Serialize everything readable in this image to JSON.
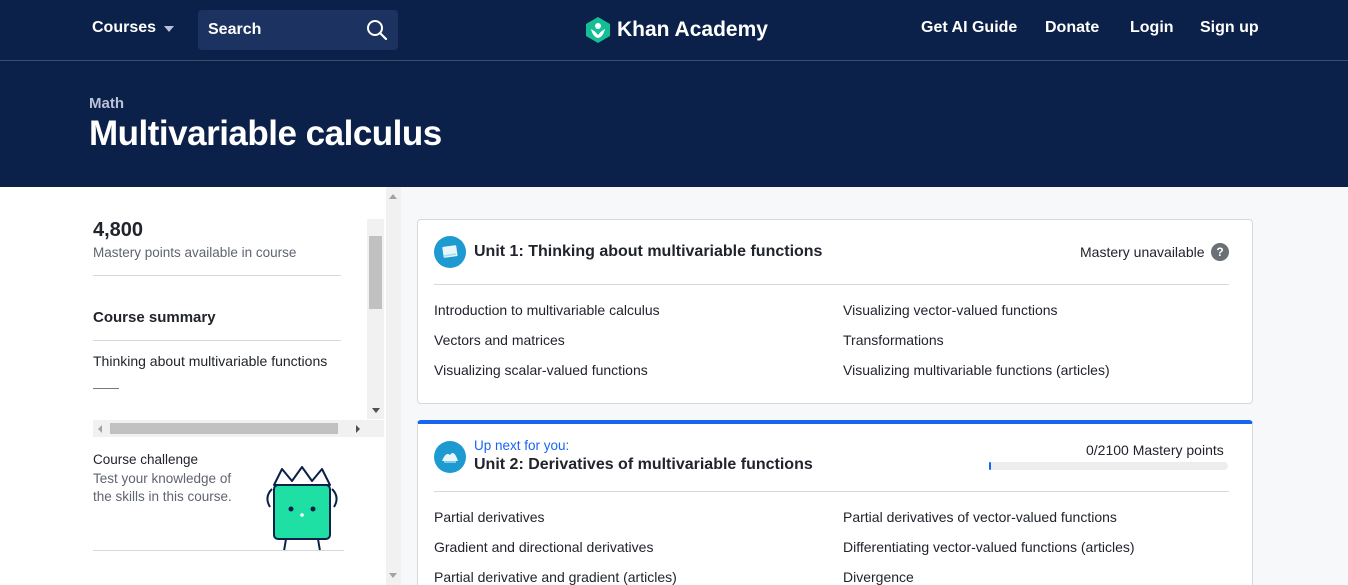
{
  "nav": {
    "courses_label": "Courses",
    "search_label": "Search",
    "logo_text": "Khan Academy",
    "links": [
      "Get AI Guide",
      "Donate",
      "Login",
      "Sign up"
    ]
  },
  "header": {
    "breadcrumb": "Math",
    "title": "Multivariable calculus"
  },
  "sidebar": {
    "mastery_points": "4,800",
    "mastery_label": "Mastery points available in course",
    "summary_title": "Course summary",
    "summary_item": "Thinking about multivariable functions",
    "summary_dash": "——",
    "challenge_title": "Course challenge",
    "challenge_desc": "Test your knowledge of the skills in this course."
  },
  "units": [
    {
      "title": "Unit 1: Thinking about multivariable functions",
      "status": "Mastery unavailable",
      "help": "?",
      "lessons_left": [
        "Introduction to multivariable calculus",
        "Vectors and matrices",
        "Visualizing scalar-valued functions"
      ],
      "lessons_right": [
        "Visualizing vector-valued functions",
        "Transformations",
        "Visualizing multivariable functions (articles)"
      ]
    },
    {
      "up_next": "Up next for you:",
      "title": "Unit 2: Derivatives of multivariable functions",
      "mastery": "0/2100 Mastery points",
      "progress": 0,
      "lessons_left": [
        "Partial derivatives",
        "Gradient and directional derivatives",
        "Partial derivative and gradient (articles)"
      ],
      "lessons_right": [
        "Partial derivatives of vector-valued functions",
        "Differentiating vector-valued functions (articles)",
        "Divergence"
      ]
    }
  ],
  "colors": {
    "navy": "#0b2149",
    "accent_blue": "#1865f2",
    "logo_green": "#14bf96",
    "unit_icon": "#1d9bd1"
  }
}
